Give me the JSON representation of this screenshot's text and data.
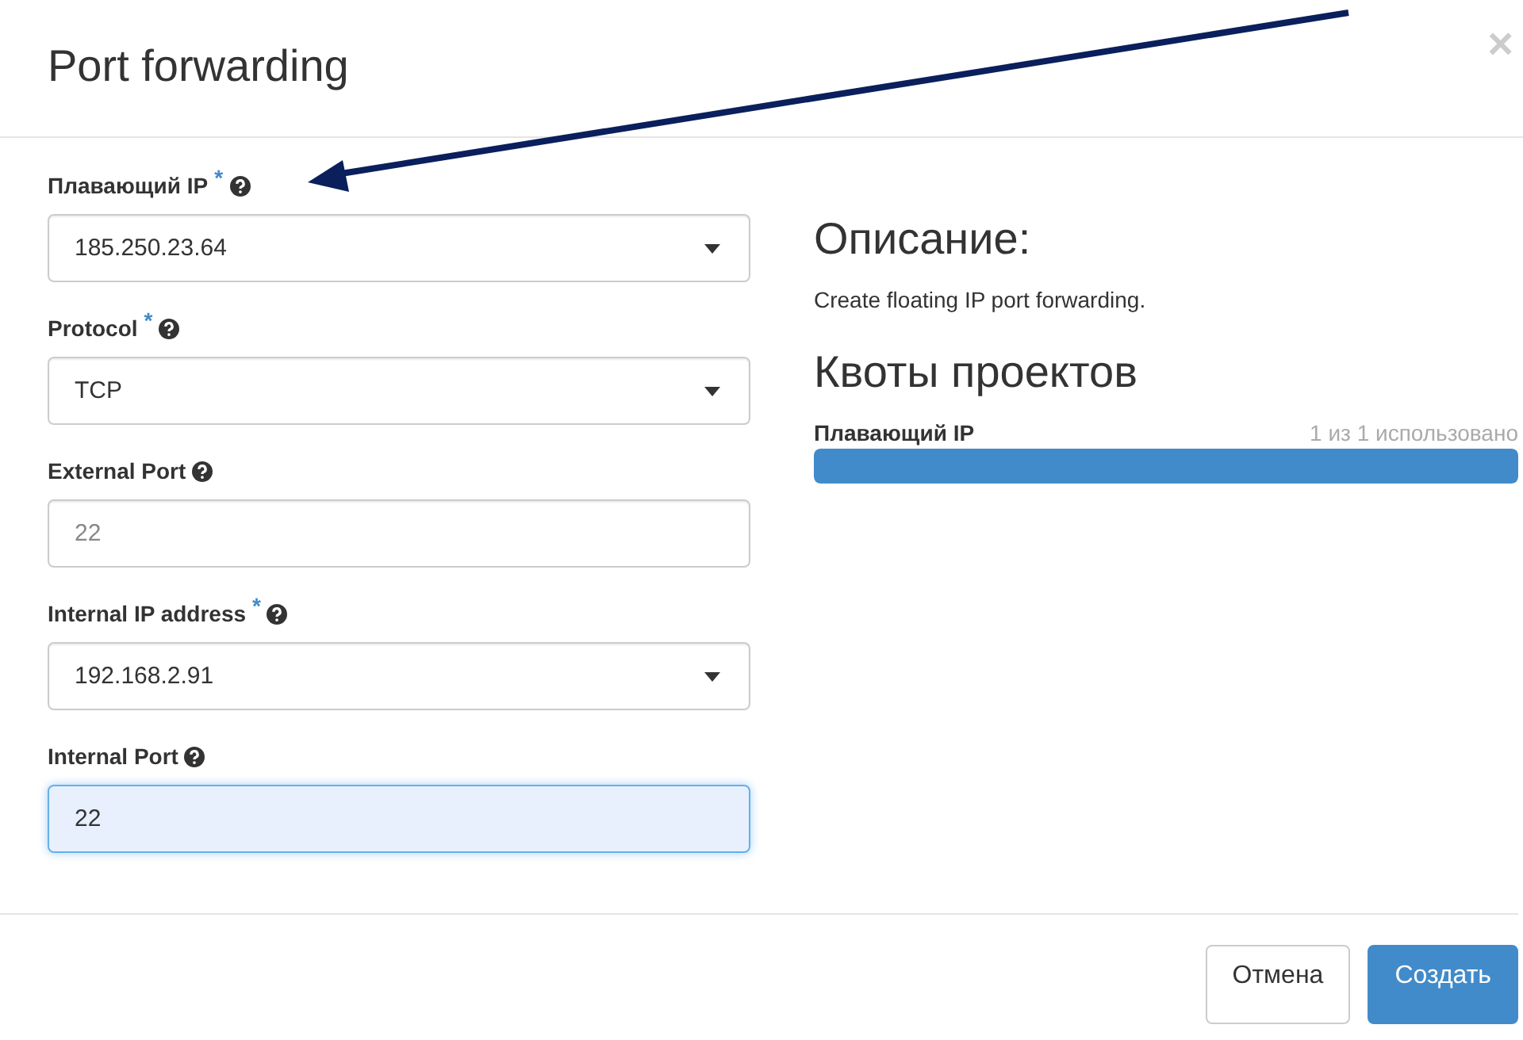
{
  "dialog": {
    "title": "Port forwarding",
    "close": "×"
  },
  "fields": [
    {
      "kind": "select",
      "label": "Плавающий IP",
      "required_mark": "*",
      "help": true,
      "value": "185.250.23.64",
      "focused": false
    },
    {
      "kind": "select",
      "label": "Protocol",
      "required_mark": "*",
      "help": true,
      "value": "TCP",
      "focused": false
    },
    {
      "kind": "input",
      "label": "External Port",
      "help": true,
      "placeholder": "22",
      "focused": false
    },
    {
      "kind": "select",
      "label": "Internal IP address",
      "required_mark": "*",
      "help": true,
      "value": "192.168.2.91",
      "focused": false
    },
    {
      "kind": "input",
      "label": "Internal Port",
      "help": true,
      "value": "22",
      "focused": true
    }
  ],
  "description": {
    "heading": "Описание:",
    "text": "Create floating IP port forwarding."
  },
  "quotas": {
    "heading": "Квоты проектов",
    "items": [
      {
        "label": "Плавающий IP",
        "reading": "1 из 1 использовано",
        "level": 1
      }
    ]
  },
  "buttons": [
    {
      "label": "Отмена",
      "kind": "default"
    },
    {
      "label": "Создать",
      "kind": "primary"
    }
  ],
  "annotation": {
    "kind": "arrow"
  }
}
